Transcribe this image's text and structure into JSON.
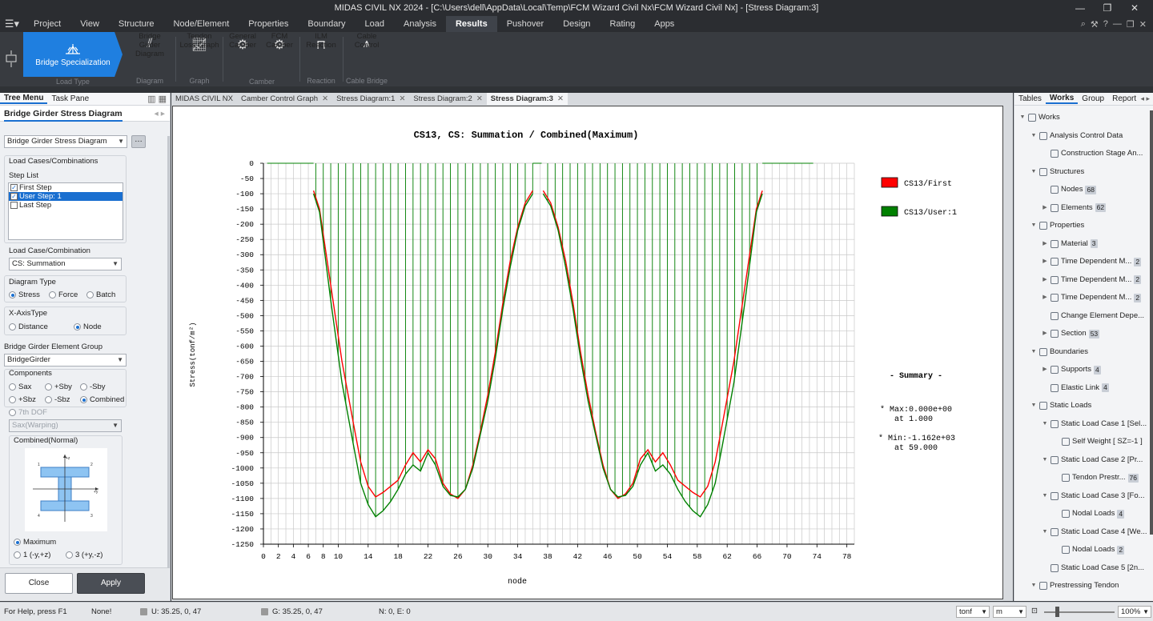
{
  "window": {
    "title": "MIDAS CIVIL NX 2024 - [C:\\Users\\dell\\AppData\\Local\\Temp\\FCM Wizard Civil Nx\\FCM Wizard Civil Nx] - [Stress Diagram:3]",
    "controls": [
      "—",
      "❐",
      "✕"
    ]
  },
  "menu": {
    "items": [
      "Project",
      "View",
      "Structure",
      "Node/Element",
      "Properties",
      "Boundary",
      "Load",
      "Analysis",
      "Results",
      "Pushover",
      "Design",
      "Rating",
      "Apps"
    ],
    "active": "Results"
  },
  "ribbon": {
    "bridge_spec": "Bridge Specialization",
    "load_type_caption": "Load Type",
    "groups": [
      {
        "label": "Bridge Girder Diagram",
        "caption": "Diagram",
        "dim": true
      },
      {
        "label": "Tendon Loss Graph",
        "caption": "Graph",
        "dim": false
      },
      {
        "label": "General Camber",
        "caption": "Camber",
        "dim": false
      },
      {
        "label": "FCM Camber",
        "caption": "",
        "dim": false
      },
      {
        "label": "ILM Reaction",
        "caption": "Reaction",
        "dim": false
      },
      {
        "label": "Cable Control",
        "caption": "Cable Bridge",
        "dim": false
      }
    ]
  },
  "left_panel": {
    "tabs": [
      "Tree Menu",
      "Task Pane"
    ],
    "title": "Bridge Girder Stress Diagram",
    "diagram_select": "Bridge Girder Stress Diagram",
    "load_cases_label": "Load Cases/Combinations",
    "step_list_label": "Step List",
    "steps": [
      {
        "label": "First Step",
        "checked": true,
        "selected": false
      },
      {
        "label": "User Step: 1",
        "checked": true,
        "selected": true
      },
      {
        "label": "Last Step",
        "checked": false,
        "selected": false
      }
    ],
    "load_case_label": "Load Case/Combination",
    "load_case_value": "CS: Summation",
    "diagram_type_label": "Diagram Type",
    "diagram_types": [
      "Stress",
      "Force",
      "Batch"
    ],
    "x_axis_label": "X-AxisType",
    "x_axis_opts": [
      "Distance",
      "Node"
    ],
    "element_group_label": "Bridge Girder Element Group",
    "element_group_value": "BridgeGirder",
    "components_label": "Components",
    "components": [
      "Sax",
      "+Sby",
      "-Sby",
      "+Sbz",
      "-Sbz",
      "Combined"
    ],
    "seventh_dof": "7th DOF",
    "warping_value": "Sax(Warping)",
    "combined_label": "Combined(Normal)",
    "maximum": "Maximum",
    "pos1": "1 (-y,+z)",
    "pos3": "3 (+y,-z)",
    "close": "Close",
    "apply": "Apply"
  },
  "doc_tabs": [
    "MIDAS CIVIL NX",
    "Camber Control Graph",
    "Stress Diagram:1",
    "Stress Diagram:2",
    "Stress Diagram:3"
  ],
  "chart_data": {
    "type": "line",
    "title": "CS13, CS: Summation / Combined(Maximum)",
    "xlabel": "node",
    "ylabel": "Stress(tonf/m²)",
    "xlim": [
      0,
      79
    ],
    "ylim": [
      -1250,
      0
    ],
    "x_ticks": [
      0,
      2,
      4,
      6,
      8,
      10,
      14,
      18,
      22,
      26,
      30,
      34,
      38,
      42,
      46,
      50,
      54,
      58,
      62,
      66,
      70,
      74,
      78
    ],
    "y_ticks": [
      0,
      -50,
      -100,
      -150,
      -200,
      -250,
      -300,
      -350,
      -400,
      -450,
      -500,
      -550,
      -600,
      -650,
      -700,
      -750,
      -800,
      -850,
      -900,
      -950,
      -1000,
      -1050,
      -1100,
      -1150,
      -1200,
      -1250
    ],
    "grid": true,
    "legend_position": "right",
    "series": [
      {
        "name": "CS13/First",
        "color": "#ff0000",
        "x": [
          6.7,
          7.5,
          9,
          10.5,
          12,
          13,
          14,
          15,
          16,
          17,
          18,
          19,
          20,
          21,
          22,
          23,
          24,
          25,
          26,
          27,
          28,
          29,
          30,
          31,
          32,
          33,
          34,
          35,
          36
        ],
        "y": [
          -90,
          -150,
          -400,
          -650,
          -850,
          -980,
          -1060,
          -1095,
          -1080,
          -1060,
          -1040,
          -990,
          -950,
          -980,
          -940,
          -970,
          -1050,
          -1085,
          -1100,
          -1070,
          -990,
          -880,
          -760,
          -620,
          -460,
          -320,
          -210,
          -130,
          -90
        ]
      },
      {
        "name": "CS13/User:1",
        "color": "#008000",
        "x": [
          6.7,
          7.5,
          9,
          10.5,
          12,
          13,
          14,
          15,
          16,
          17,
          18,
          19,
          20,
          21,
          22,
          23,
          24,
          25,
          26,
          27,
          28,
          29,
          30,
          31,
          32,
          33,
          34,
          35,
          36
        ],
        "y": [
          -100,
          -160,
          -450,
          -720,
          -920,
          -1050,
          -1120,
          -1160,
          -1140,
          -1110,
          -1070,
          -1020,
          -990,
          -1010,
          -950,
          -990,
          -1060,
          -1090,
          -1095,
          -1070,
          -1000,
          -890,
          -780,
          -640,
          -480,
          -340,
          -220,
          -140,
          -100
        ]
      }
    ],
    "summary": {
      "title": "- Summary -",
      "max_line1": "* Max:0.000e+00",
      "max_line2": "at  1.000",
      "min_line1": "* Min:-1.162e+03",
      "min_line2": "at 59.000"
    }
  },
  "right_panel": {
    "tabs": [
      "Tables",
      "Works",
      "Group",
      "Report"
    ],
    "active": "Works",
    "tree": [
      {
        "level": 0,
        "label": "Works",
        "expanded": true,
        "badge": ""
      },
      {
        "level": 1,
        "label": "Analysis Control Data",
        "expanded": true,
        "badge": ""
      },
      {
        "level": 2,
        "label": "Construction Stage An...",
        "expanded": null,
        "badge": ""
      },
      {
        "level": 1,
        "label": "Structures",
        "expanded": true,
        "badge": ""
      },
      {
        "level": 2,
        "label": "Nodes",
        "expanded": null,
        "badge": "68"
      },
      {
        "level": 2,
        "label": "Elements",
        "expanded": false,
        "badge": "62"
      },
      {
        "level": 1,
        "label": "Properties",
        "expanded": true,
        "badge": ""
      },
      {
        "level": 2,
        "label": "Material",
        "expanded": false,
        "badge": "3"
      },
      {
        "level": 2,
        "label": "Time Dependent M...",
        "expanded": false,
        "badge": "2"
      },
      {
        "level": 2,
        "label": "Time Dependent M...",
        "expanded": false,
        "badge": "2"
      },
      {
        "level": 2,
        "label": "Time Dependent M...",
        "expanded": false,
        "badge": "2"
      },
      {
        "level": 2,
        "label": "Change Element Depe...",
        "expanded": null,
        "badge": ""
      },
      {
        "level": 2,
        "label": "Section",
        "expanded": false,
        "badge": "53"
      },
      {
        "level": 1,
        "label": "Boundaries",
        "expanded": true,
        "badge": ""
      },
      {
        "level": 2,
        "label": "Supports",
        "expanded": false,
        "badge": "4"
      },
      {
        "level": 2,
        "label": "Elastic Link",
        "expanded": null,
        "badge": "4"
      },
      {
        "level": 1,
        "label": "Static Loads",
        "expanded": true,
        "badge": ""
      },
      {
        "level": 2,
        "label": "Static Load Case 1 [Sel...",
        "expanded": true,
        "badge": ""
      },
      {
        "level": 3,
        "label": "Self Weight [ SZ=-1 ]",
        "expanded": null,
        "badge": ""
      },
      {
        "level": 2,
        "label": "Static Load Case 2 [Pr...",
        "expanded": true,
        "badge": ""
      },
      {
        "level": 3,
        "label": "Tendon Prestr...",
        "expanded": null,
        "badge": "76"
      },
      {
        "level": 2,
        "label": "Static Load Case 3 [Fo...",
        "expanded": true,
        "badge": ""
      },
      {
        "level": 3,
        "label": "Nodal Loads",
        "expanded": null,
        "badge": "4"
      },
      {
        "level": 2,
        "label": "Static Load Case 4 [We...",
        "expanded": true,
        "badge": ""
      },
      {
        "level": 3,
        "label": "Nodal Loads",
        "expanded": null,
        "badge": "2"
      },
      {
        "level": 2,
        "label": "Static Load Case 5 [2n...",
        "expanded": null,
        "badge": ""
      },
      {
        "level": 1,
        "label": "Prestressing Tendon",
        "expanded": true,
        "badge": ""
      }
    ]
  },
  "status": {
    "help": "For Help, press F1",
    "none": "None!",
    "u": "U: 35.25, 0, 47",
    "g": "G: 35.25, 0, 47",
    "ne": "N: 0, E: 0",
    "unit_force": "tonf",
    "unit_len": "m",
    "zoom": "100%"
  }
}
